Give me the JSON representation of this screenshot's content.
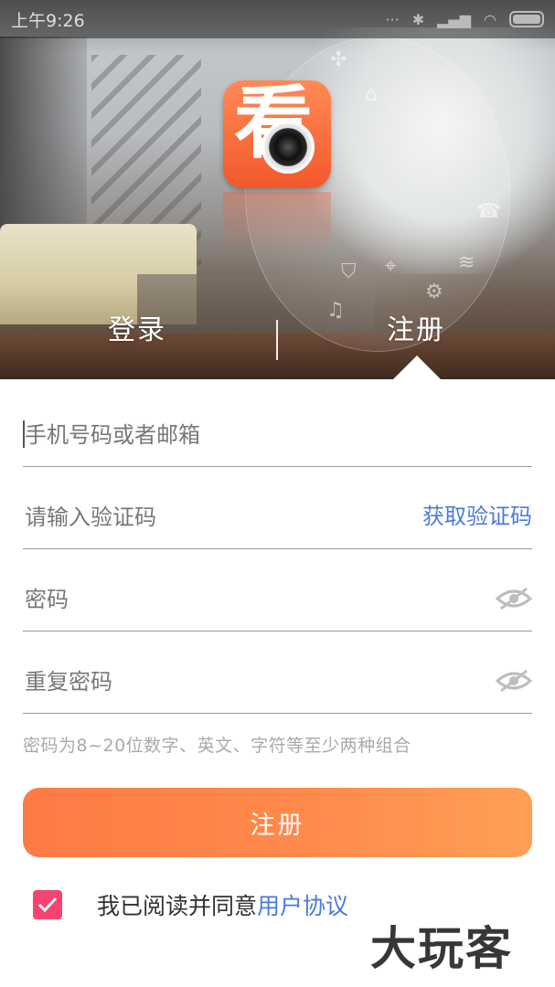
{
  "status_bar": {
    "time": "上午9:26"
  },
  "app": {
    "logo_char": "看",
    "logo_icon": "camera-lens-icon",
    "brand_color": "#f2582c"
  },
  "tabs": {
    "login_label": "登录",
    "register_label": "注册",
    "active": "register"
  },
  "form": {
    "account": {
      "placeholder": "手机号码或者邮箱",
      "value": ""
    },
    "code": {
      "placeholder": "请输入验证码",
      "value": "",
      "action_label": "获取验证码"
    },
    "password": {
      "placeholder": "密码",
      "value": "",
      "toggle_icon": "eye-hidden-icon"
    },
    "password_repeat": {
      "placeholder": "重复密码",
      "value": "",
      "toggle_icon": "eye-hidden-icon"
    },
    "hint": "密码为8~20位数字、英文、字符等至少两种组合",
    "submit_label": "注册"
  },
  "agreement": {
    "checked": true,
    "text": "我已阅读并同意",
    "link_label": "用户协议"
  },
  "watermark": "大玩客",
  "colors": {
    "accent_orange": "#ff8a4a",
    "link_blue": "#4a7bd9",
    "checkbox_pink": "#f5446f"
  }
}
